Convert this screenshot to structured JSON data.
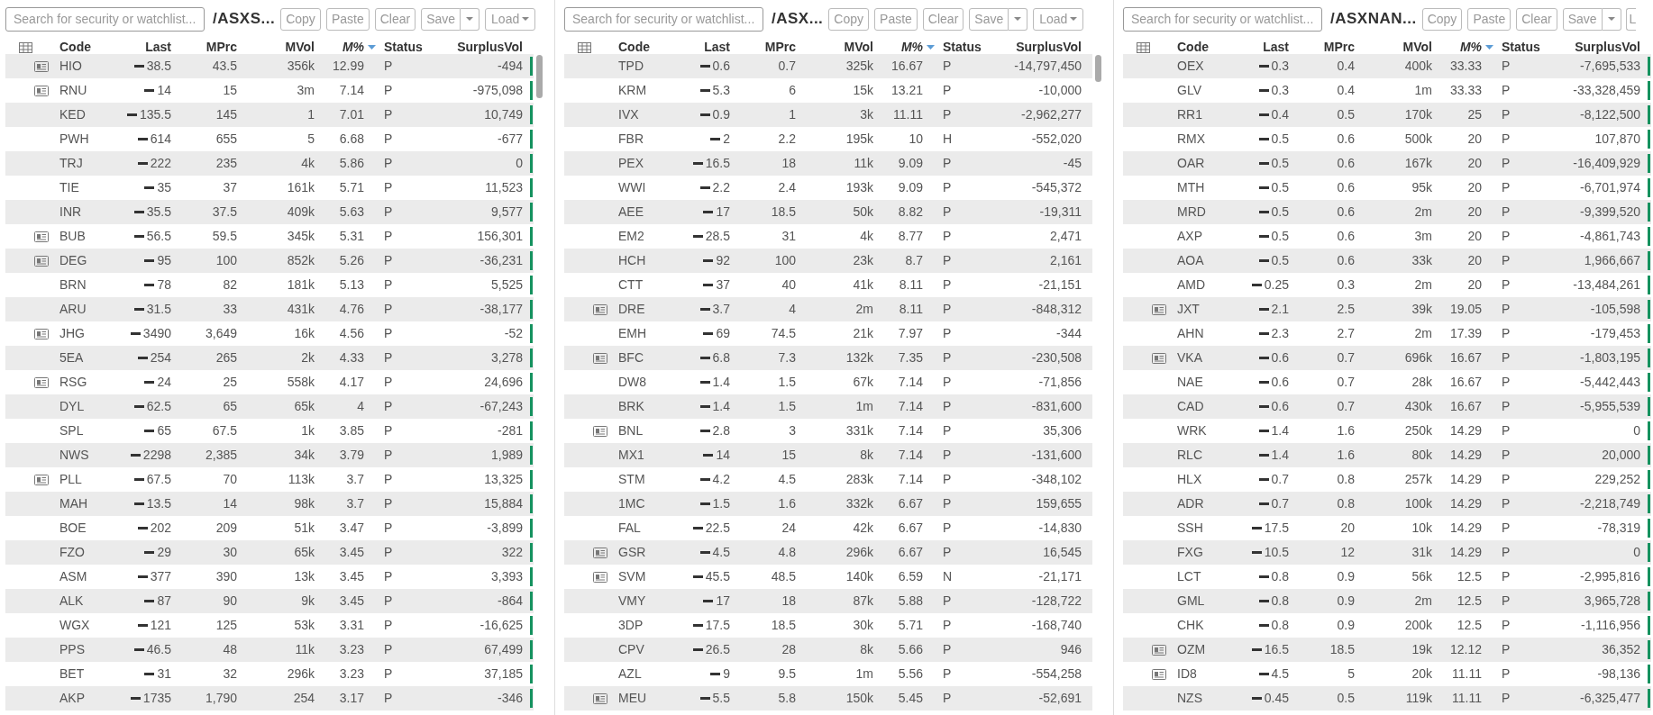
{
  "panels": [
    {
      "search": {
        "placeholder": "Search for security or watchlist..."
      },
      "title": "/ASXS...",
      "buttons": {
        "copy": "Copy",
        "paste": "Paste",
        "clear": "Clear",
        "save": "Save",
        "load": {
          "label": "Load",
          "cut": false
        }
      },
      "scrollbar": true,
      "columns": [
        "Code",
        "Last",
        "MPrc",
        "MVol",
        "M%",
        "Status",
        "SurplusVol"
      ],
      "rows": [
        {
          "news": true,
          "code": "HIO",
          "last": "38.5",
          "mprc": "43.5",
          "mvol": "356k",
          "mpct": "12.99",
          "status": "P",
          "surplus": "-494",
          "marker": true
        },
        {
          "news": true,
          "code": "RNU",
          "last": "14",
          "mprc": "15",
          "mvol": "3m",
          "mpct": "7.14",
          "status": "P",
          "surplus": "-975,098",
          "marker": true
        },
        {
          "news": false,
          "code": "KED",
          "last": "135.5",
          "mprc": "145",
          "mvol": "1",
          "mpct": "7.01",
          "status": "P",
          "surplus": "10,749",
          "marker": true
        },
        {
          "news": false,
          "code": "PWH",
          "last": "614",
          "mprc": "655",
          "mvol": "5",
          "mpct": "6.68",
          "status": "P",
          "surplus": "-677",
          "marker": true
        },
        {
          "news": false,
          "code": "TRJ",
          "last": "222",
          "mprc": "235",
          "mvol": "4k",
          "mpct": "5.86",
          "status": "P",
          "surplus": "0",
          "marker": true
        },
        {
          "news": false,
          "code": "TIE",
          "last": "35",
          "mprc": "37",
          "mvol": "161k",
          "mpct": "5.71",
          "status": "P",
          "surplus": "11,523",
          "marker": true
        },
        {
          "news": false,
          "code": "INR",
          "last": "35.5",
          "mprc": "37.5",
          "mvol": "409k",
          "mpct": "5.63",
          "status": "P",
          "surplus": "9,577",
          "marker": true
        },
        {
          "news": true,
          "code": "BUB",
          "last": "56.5",
          "mprc": "59.5",
          "mvol": "345k",
          "mpct": "5.31",
          "status": "P",
          "surplus": "156,301",
          "marker": true
        },
        {
          "news": true,
          "code": "DEG",
          "last": "95",
          "mprc": "100",
          "mvol": "852k",
          "mpct": "5.26",
          "status": "P",
          "surplus": "-36,231",
          "marker": true
        },
        {
          "news": false,
          "code": "BRN",
          "last": "78",
          "mprc": "82",
          "mvol": "181k",
          "mpct": "5.13",
          "status": "P",
          "surplus": "5,525",
          "marker": true
        },
        {
          "news": false,
          "code": "ARU",
          "last": "31.5",
          "mprc": "33",
          "mvol": "431k",
          "mpct": "4.76",
          "status": "P",
          "surplus": "-38,177",
          "marker": true
        },
        {
          "news": true,
          "code": "JHG",
          "last": "3490",
          "mprc": "3,649",
          "mvol": "16k",
          "mpct": "4.56",
          "status": "P",
          "surplus": "-52",
          "marker": true
        },
        {
          "news": false,
          "code": "5EA",
          "last": "254",
          "mprc": "265",
          "mvol": "2k",
          "mpct": "4.33",
          "status": "P",
          "surplus": "3,278",
          "marker": true
        },
        {
          "news": true,
          "code": "RSG",
          "last": "24",
          "mprc": "25",
          "mvol": "558k",
          "mpct": "4.17",
          "status": "P",
          "surplus": "24,696",
          "marker": true
        },
        {
          "news": false,
          "code": "DYL",
          "last": "62.5",
          "mprc": "65",
          "mvol": "65k",
          "mpct": "4",
          "status": "P",
          "surplus": "-67,243",
          "marker": true
        },
        {
          "news": false,
          "code": "SPL",
          "last": "65",
          "mprc": "67.5",
          "mvol": "1k",
          "mpct": "3.85",
          "status": "P",
          "surplus": "-281",
          "marker": true
        },
        {
          "news": false,
          "code": "NWS",
          "last": "2298",
          "mprc": "2,385",
          "mvol": "34k",
          "mpct": "3.79",
          "status": "P",
          "surplus": "1,989",
          "marker": true
        },
        {
          "news": true,
          "code": "PLL",
          "last": "67.5",
          "mprc": "70",
          "mvol": "113k",
          "mpct": "3.7",
          "status": "P",
          "surplus": "13,325",
          "marker": true
        },
        {
          "news": false,
          "code": "MAH",
          "last": "13.5",
          "mprc": "14",
          "mvol": "98k",
          "mpct": "3.7",
          "status": "P",
          "surplus": "15,884",
          "marker": true
        },
        {
          "news": false,
          "code": "BOE",
          "last": "202",
          "mprc": "209",
          "mvol": "51k",
          "mpct": "3.47",
          "status": "P",
          "surplus": "-3,899",
          "marker": true
        },
        {
          "news": false,
          "code": "FZO",
          "last": "29",
          "mprc": "30",
          "mvol": "65k",
          "mpct": "3.45",
          "status": "P",
          "surplus": "322",
          "marker": true
        },
        {
          "news": false,
          "code": "ASM",
          "last": "377",
          "mprc": "390",
          "mvol": "13k",
          "mpct": "3.45",
          "status": "P",
          "surplus": "3,393",
          "marker": true
        },
        {
          "news": false,
          "code": "ALK",
          "last": "87",
          "mprc": "90",
          "mvol": "9k",
          "mpct": "3.45",
          "status": "P",
          "surplus": "-864",
          "marker": true
        },
        {
          "news": false,
          "code": "WGX",
          "last": "121",
          "mprc": "125",
          "mvol": "53k",
          "mpct": "3.31",
          "status": "P",
          "surplus": "-16,625",
          "marker": true
        },
        {
          "news": false,
          "code": "PPS",
          "last": "46.5",
          "mprc": "48",
          "mvol": "11k",
          "mpct": "3.23",
          "status": "P",
          "surplus": "67,499",
          "marker": true
        },
        {
          "news": false,
          "code": "BET",
          "last": "31",
          "mprc": "32",
          "mvol": "296k",
          "mpct": "3.23",
          "status": "P",
          "surplus": "37,185",
          "marker": true
        },
        {
          "news": false,
          "code": "AKP",
          "last": "1735",
          "mprc": "1,790",
          "mvol": "254",
          "mpct": "3.17",
          "status": "P",
          "surplus": "-346",
          "marker": true
        }
      ]
    },
    {
      "search": {
        "placeholder": "Search for security or watchlist..."
      },
      "title": "/ASX...",
      "buttons": {
        "copy": "Copy",
        "paste": "Paste",
        "clear": "Clear",
        "save": "Save",
        "load": {
          "label": "Load",
          "cut": false
        }
      },
      "scrollbar": true,
      "columns": [
        "Code",
        "Last",
        "MPrc",
        "MVol",
        "M%",
        "Status",
        "SurplusVol"
      ],
      "rows": [
        {
          "news": false,
          "code": "TPD",
          "last": "0.6",
          "mprc": "0.7",
          "mvol": "325k",
          "mpct": "16.67",
          "status": "P",
          "surplus": "-14,797,450",
          "marker": false
        },
        {
          "news": false,
          "code": "KRM",
          "last": "5.3",
          "mprc": "6",
          "mvol": "15k",
          "mpct": "13.21",
          "status": "P",
          "surplus": "-10,000",
          "marker": false
        },
        {
          "news": false,
          "code": "IVX",
          "last": "0.9",
          "mprc": "1",
          "mvol": "3k",
          "mpct": "11.11",
          "status": "P",
          "surplus": "-2,962,277",
          "marker": false
        },
        {
          "news": false,
          "code": "FBR",
          "last": "2",
          "mprc": "2.2",
          "mvol": "195k",
          "mpct": "10",
          "status": "H",
          "surplus": "-552,020",
          "marker": false
        },
        {
          "news": false,
          "code": "PEX",
          "last": "16.5",
          "mprc": "18",
          "mvol": "11k",
          "mpct": "9.09",
          "status": "P",
          "surplus": "-45",
          "marker": false
        },
        {
          "news": false,
          "code": "WWI",
          "last": "2.2",
          "mprc": "2.4",
          "mvol": "193k",
          "mpct": "9.09",
          "status": "P",
          "surplus": "-545,372",
          "marker": false
        },
        {
          "news": false,
          "code": "AEE",
          "last": "17",
          "mprc": "18.5",
          "mvol": "50k",
          "mpct": "8.82",
          "status": "P",
          "surplus": "-19,311",
          "marker": false
        },
        {
          "news": false,
          "code": "EM2",
          "last": "28.5",
          "mprc": "31",
          "mvol": "4k",
          "mpct": "8.77",
          "status": "P",
          "surplus": "2,471",
          "marker": false
        },
        {
          "news": false,
          "code": "HCH",
          "last": "92",
          "mprc": "100",
          "mvol": "23k",
          "mpct": "8.7",
          "status": "P",
          "surplus": "2,161",
          "marker": false
        },
        {
          "news": false,
          "code": "CTT",
          "last": "37",
          "mprc": "40",
          "mvol": "41k",
          "mpct": "8.11",
          "status": "P",
          "surplus": "-21,151",
          "marker": false
        },
        {
          "news": true,
          "code": "DRE",
          "last": "3.7",
          "mprc": "4",
          "mvol": "2m",
          "mpct": "8.11",
          "status": "P",
          "surplus": "-848,312",
          "marker": false
        },
        {
          "news": false,
          "code": "EMH",
          "last": "69",
          "mprc": "74.5",
          "mvol": "21k",
          "mpct": "7.97",
          "status": "P",
          "surplus": "-344",
          "marker": false
        },
        {
          "news": true,
          "code": "BFC",
          "last": "6.8",
          "mprc": "7.3",
          "mvol": "132k",
          "mpct": "7.35",
          "status": "P",
          "surplus": "-230,508",
          "marker": false
        },
        {
          "news": false,
          "code": "DW8",
          "last": "1.4",
          "mprc": "1.5",
          "mvol": "67k",
          "mpct": "7.14",
          "status": "P",
          "surplus": "-71,856",
          "marker": false
        },
        {
          "news": false,
          "code": "BRK",
          "last": "1.4",
          "mprc": "1.5",
          "mvol": "1m",
          "mpct": "7.14",
          "status": "P",
          "surplus": "-831,600",
          "marker": false
        },
        {
          "news": true,
          "code": "BNL",
          "last": "2.8",
          "mprc": "3",
          "mvol": "331k",
          "mpct": "7.14",
          "status": "P",
          "surplus": "35,306",
          "marker": false
        },
        {
          "news": false,
          "code": "MX1",
          "last": "14",
          "mprc": "15",
          "mvol": "8k",
          "mpct": "7.14",
          "status": "P",
          "surplus": "-131,600",
          "marker": false
        },
        {
          "news": false,
          "code": "STM",
          "last": "4.2",
          "mprc": "4.5",
          "mvol": "283k",
          "mpct": "7.14",
          "status": "P",
          "surplus": "-348,102",
          "marker": false
        },
        {
          "news": false,
          "code": "1MC",
          "last": "1.5",
          "mprc": "1.6",
          "mvol": "332k",
          "mpct": "6.67",
          "status": "P",
          "surplus": "159,655",
          "marker": false
        },
        {
          "news": false,
          "code": "FAL",
          "last": "22.5",
          "mprc": "24",
          "mvol": "42k",
          "mpct": "6.67",
          "status": "P",
          "surplus": "-14,830",
          "marker": false
        },
        {
          "news": true,
          "code": "GSR",
          "last": "4.5",
          "mprc": "4.8",
          "mvol": "296k",
          "mpct": "6.67",
          "status": "P",
          "surplus": "16,545",
          "marker": false
        },
        {
          "news": true,
          "code": "SVM",
          "last": "45.5",
          "mprc": "48.5",
          "mvol": "140k",
          "mpct": "6.59",
          "status": "N",
          "surplus": "-21,171",
          "marker": false
        },
        {
          "news": false,
          "code": "VMY",
          "last": "17",
          "mprc": "18",
          "mvol": "87k",
          "mpct": "5.88",
          "status": "P",
          "surplus": "-128,722",
          "marker": false
        },
        {
          "news": false,
          "code": "3DP",
          "last": "17.5",
          "mprc": "18.5",
          "mvol": "30k",
          "mpct": "5.71",
          "status": "P",
          "surplus": "-168,740",
          "marker": false
        },
        {
          "news": false,
          "code": "CPV",
          "last": "26.5",
          "mprc": "28",
          "mvol": "8k",
          "mpct": "5.66",
          "status": "P",
          "surplus": "946",
          "marker": false
        },
        {
          "news": false,
          "code": "AZL",
          "last": "9",
          "mprc": "9.5",
          "mvol": "1m",
          "mpct": "5.56",
          "status": "P",
          "surplus": "-554,258",
          "marker": false
        },
        {
          "news": true,
          "code": "MEU",
          "last": "5.5",
          "mprc": "5.8",
          "mvol": "150k",
          "mpct": "5.45",
          "status": "P",
          "surplus": "-52,691",
          "marker": false
        }
      ]
    },
    {
      "search": {
        "placeholder": "Search for security or watchlist..."
      },
      "title": "/ASXNAN...",
      "buttons": {
        "copy": "Copy",
        "paste": "Paste",
        "clear": "Clear",
        "save": "Save",
        "load": {
          "label": "L",
          "cut": true
        }
      },
      "scrollbar": false,
      "columns": [
        "Code",
        "Last",
        "MPrc",
        "MVol",
        "M%",
        "Status",
        "SurplusVol"
      ],
      "rows": [
        {
          "news": false,
          "code": "OEX",
          "last": "0.3",
          "mprc": "0.4",
          "mvol": "400k",
          "mpct": "33.33",
          "status": "P",
          "surplus": "-7,695,533",
          "marker": true
        },
        {
          "news": false,
          "code": "GLV",
          "last": "0.3",
          "mprc": "0.4",
          "mvol": "1m",
          "mpct": "33.33",
          "status": "P",
          "surplus": "-33,328,459",
          "marker": true
        },
        {
          "news": false,
          "code": "RR1",
          "last": "0.4",
          "mprc": "0.5",
          "mvol": "170k",
          "mpct": "25",
          "status": "P",
          "surplus": "-8,122,500",
          "marker": true
        },
        {
          "news": false,
          "code": "RMX",
          "last": "0.5",
          "mprc": "0.6",
          "mvol": "500k",
          "mpct": "20",
          "status": "P",
          "surplus": "107,870",
          "marker": true
        },
        {
          "news": false,
          "code": "OAR",
          "last": "0.5",
          "mprc": "0.6",
          "mvol": "167k",
          "mpct": "20",
          "status": "P",
          "surplus": "-16,409,929",
          "marker": true
        },
        {
          "news": false,
          "code": "MTH",
          "last": "0.5",
          "mprc": "0.6",
          "mvol": "95k",
          "mpct": "20",
          "status": "P",
          "surplus": "-6,701,974",
          "marker": true
        },
        {
          "news": false,
          "code": "MRD",
          "last": "0.5",
          "mprc": "0.6",
          "mvol": "2m",
          "mpct": "20",
          "status": "P",
          "surplus": "-9,399,520",
          "marker": true
        },
        {
          "news": false,
          "code": "AXP",
          "last": "0.5",
          "mprc": "0.6",
          "mvol": "3m",
          "mpct": "20",
          "status": "P",
          "surplus": "-4,861,743",
          "marker": true
        },
        {
          "news": false,
          "code": "AOA",
          "last": "0.5",
          "mprc": "0.6",
          "mvol": "33k",
          "mpct": "20",
          "status": "P",
          "surplus": "1,966,667",
          "marker": true
        },
        {
          "news": false,
          "code": "AMD",
          "last": "0.25",
          "mprc": "0.3",
          "mvol": "2m",
          "mpct": "20",
          "status": "P",
          "surplus": "-13,484,261",
          "marker": true
        },
        {
          "news": true,
          "code": "JXT",
          "last": "2.1",
          "mprc": "2.5",
          "mvol": "39k",
          "mpct": "19.05",
          "status": "P",
          "surplus": "-105,598",
          "marker": true
        },
        {
          "news": false,
          "code": "AHN",
          "last": "2.3",
          "mprc": "2.7",
          "mvol": "2m",
          "mpct": "17.39",
          "status": "P",
          "surplus": "-179,453",
          "marker": true
        },
        {
          "news": true,
          "code": "VKA",
          "last": "0.6",
          "mprc": "0.7",
          "mvol": "696k",
          "mpct": "16.67",
          "status": "P",
          "surplus": "-1,803,195",
          "marker": true
        },
        {
          "news": false,
          "code": "NAE",
          "last": "0.6",
          "mprc": "0.7",
          "mvol": "28k",
          "mpct": "16.67",
          "status": "P",
          "surplus": "-5,442,443",
          "marker": true
        },
        {
          "news": false,
          "code": "CAD",
          "last": "0.6",
          "mprc": "0.7",
          "mvol": "430k",
          "mpct": "16.67",
          "status": "P",
          "surplus": "-5,955,539",
          "marker": true
        },
        {
          "news": false,
          "code": "WRK",
          "last": "1.4",
          "mprc": "1.6",
          "mvol": "250k",
          "mpct": "14.29",
          "status": "P",
          "surplus": "0",
          "marker": true
        },
        {
          "news": false,
          "code": "RLC",
          "last": "1.4",
          "mprc": "1.6",
          "mvol": "80k",
          "mpct": "14.29",
          "status": "P",
          "surplus": "20,000",
          "marker": true
        },
        {
          "news": false,
          "code": "HLX",
          "last": "0.7",
          "mprc": "0.8",
          "mvol": "257k",
          "mpct": "14.29",
          "status": "P",
          "surplus": "229,252",
          "marker": true
        },
        {
          "news": false,
          "code": "ADR",
          "last": "0.7",
          "mprc": "0.8",
          "mvol": "100k",
          "mpct": "14.29",
          "status": "P",
          "surplus": "-2,218,749",
          "marker": true
        },
        {
          "news": false,
          "code": "SSH",
          "last": "17.5",
          "mprc": "20",
          "mvol": "10k",
          "mpct": "14.29",
          "status": "P",
          "surplus": "-78,319",
          "marker": true
        },
        {
          "news": false,
          "code": "FXG",
          "last": "10.5",
          "mprc": "12",
          "mvol": "31k",
          "mpct": "14.29",
          "status": "P",
          "surplus": "0",
          "marker": true
        },
        {
          "news": false,
          "code": "LCT",
          "last": "0.8",
          "mprc": "0.9",
          "mvol": "56k",
          "mpct": "12.5",
          "status": "P",
          "surplus": "-2,995,816",
          "marker": true
        },
        {
          "news": false,
          "code": "GML",
          "last": "0.8",
          "mprc": "0.9",
          "mvol": "2m",
          "mpct": "12.5",
          "status": "P",
          "surplus": "3,965,728",
          "marker": true
        },
        {
          "news": false,
          "code": "CHK",
          "last": "0.8",
          "mprc": "0.9",
          "mvol": "200k",
          "mpct": "12.5",
          "status": "P",
          "surplus": "-1,116,956",
          "marker": true
        },
        {
          "news": true,
          "code": "OZM",
          "last": "16.5",
          "mprc": "18.5",
          "mvol": "19k",
          "mpct": "12.12",
          "status": "P",
          "surplus": "36,352",
          "marker": true
        },
        {
          "news": true,
          "code": "ID8",
          "last": "4.5",
          "mprc": "5",
          "mvol": "20k",
          "mpct": "11.11",
          "status": "P",
          "surplus": "-98,136",
          "marker": true
        },
        {
          "news": false,
          "code": "NZS",
          "last": "0.45",
          "mprc": "0.5",
          "mvol": "119k",
          "mpct": "11.11",
          "status": "P",
          "surplus": "-6,325,477",
          "marker": true
        }
      ]
    }
  ]
}
